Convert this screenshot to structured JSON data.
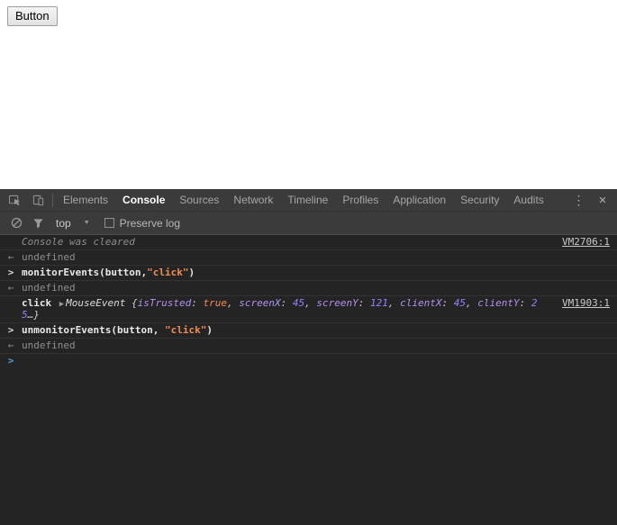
{
  "theme": {
    "devtools_bg": "#242424",
    "chrome_bg": "#3b3b3b",
    "text_light": "#e8e8e8",
    "text_muted": "#8e8e8e",
    "prompt_blue": "#4a9ee8",
    "string_orange": "#f28b54",
    "number_purple": "#9980ff",
    "property_violet": "#b392f0",
    "link_gray": "#c8c8c8",
    "row_border": "#333333"
  },
  "icons": {
    "menu": "⋮",
    "close": "×",
    "dropdown": "▼",
    "expand_triangle": "▶",
    "result_arrow": "←",
    "prompt_chevron": ">",
    "command_chevron": ">"
  },
  "page": {
    "button_label": "Button"
  },
  "devtools": {
    "tab_bar": {
      "tabs": [
        "Elements",
        "Console",
        "Sources",
        "Network",
        "Timeline",
        "Profiles",
        "Application",
        "Security",
        "Audits"
      ],
      "active_tab": "Console"
    },
    "console_toolbar": {
      "context_selector": "top",
      "preserve_log_label": "Preserve log",
      "preserve_log_checked": false
    },
    "console": {
      "rows": [
        {
          "kind": "info",
          "text": "Console was cleared",
          "link": "VM2706:1"
        },
        {
          "kind": "result",
          "text": "undefined"
        },
        {
          "kind": "command",
          "tokens": [
            {
              "t": "code",
              "v": "monitorEvents(button,"
            },
            {
              "t": "string",
              "v": "\"click\""
            },
            {
              "t": "code",
              "v": ")"
            }
          ]
        },
        {
          "kind": "result",
          "text": "undefined"
        },
        {
          "kind": "log",
          "link": "VM1903:1",
          "tokens": [
            {
              "t": "bold",
              "v": "click "
            },
            {
              "t": "triangle",
              "v": "▶"
            },
            {
              "t": "objname",
              "v": "MouseEvent "
            },
            {
              "t": "preview",
              "v": "{"
            },
            {
              "t": "prop",
              "v": "isTrusted"
            },
            {
              "t": "preview",
              "v": ": "
            },
            {
              "t": "bool",
              "v": "true"
            },
            {
              "t": "preview",
              "v": ", "
            },
            {
              "t": "prop",
              "v": "screenX"
            },
            {
              "t": "preview",
              "v": ": "
            },
            {
              "t": "num",
              "v": "45"
            },
            {
              "t": "preview",
              "v": ", "
            },
            {
              "t": "prop",
              "v": "screenY"
            },
            {
              "t": "preview",
              "v": ": "
            },
            {
              "t": "num",
              "v": "121"
            },
            {
              "t": "preview",
              "v": ", "
            },
            {
              "t": "prop",
              "v": "clientX"
            },
            {
              "t": "preview",
              "v": ": "
            },
            {
              "t": "num",
              "v": "45"
            },
            {
              "t": "preview",
              "v": ", "
            },
            {
              "t": "prop",
              "v": "clientY"
            },
            {
              "t": "preview",
              "v": ": "
            },
            {
              "t": "num",
              "v": "25"
            },
            {
              "t": "preview",
              "v": "…}"
            }
          ]
        },
        {
          "kind": "command",
          "tokens": [
            {
              "t": "code",
              "v": "unmonitorEvents(button, "
            },
            {
              "t": "string",
              "v": "\"click\""
            },
            {
              "t": "code",
              "v": ")"
            }
          ]
        },
        {
          "kind": "result",
          "text": "undefined"
        },
        {
          "kind": "prompt"
        }
      ]
    }
  }
}
